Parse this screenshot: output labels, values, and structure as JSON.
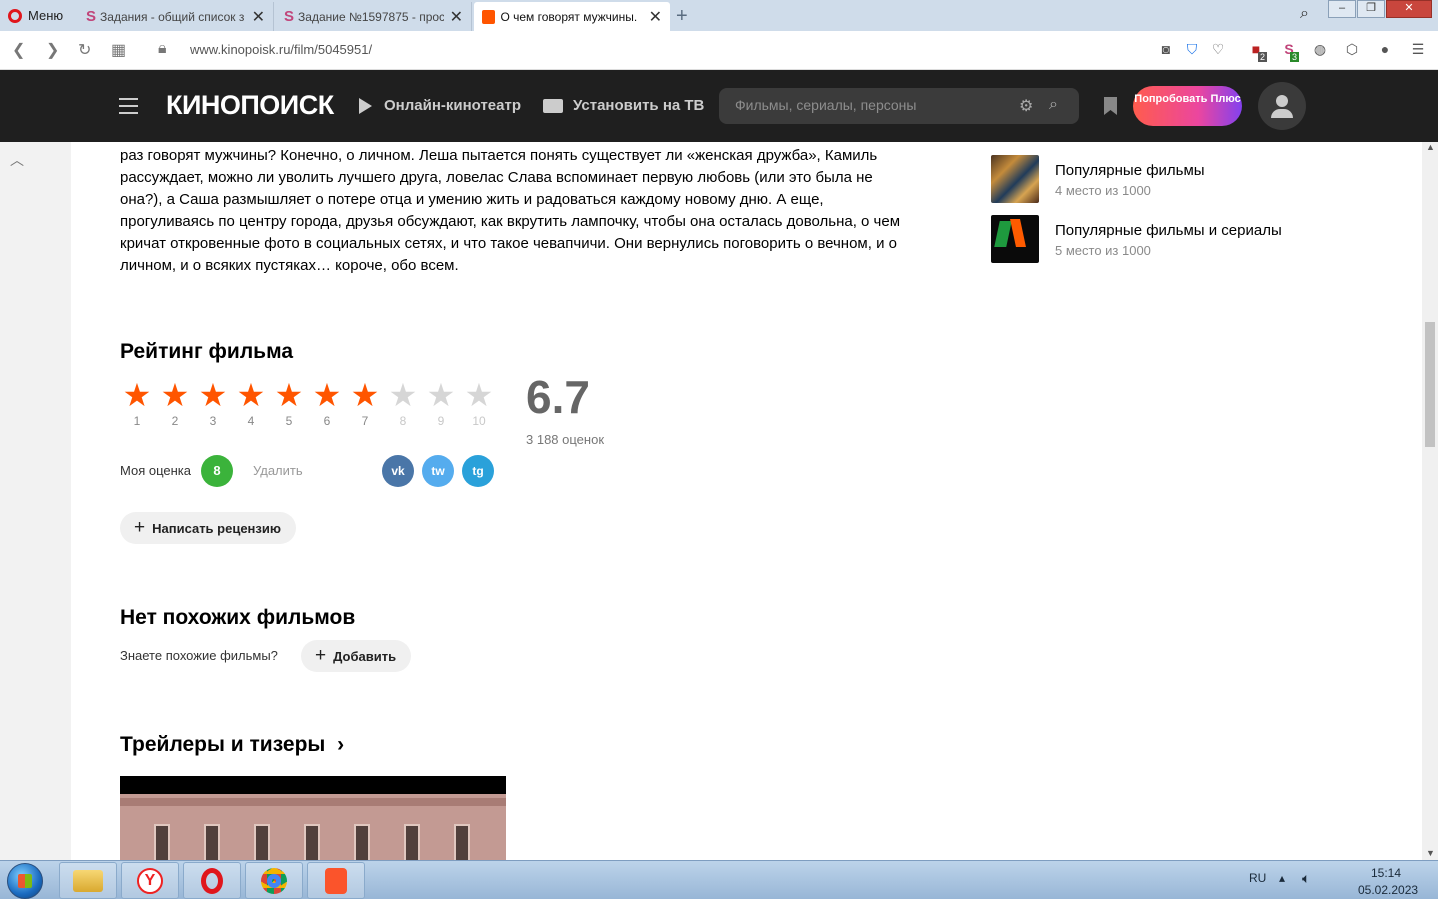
{
  "browser": {
    "menu_label": "Меню",
    "tabs": [
      {
        "icon": "SP",
        "title": "Задания - общий список з",
        "active": false
      },
      {
        "icon": "SP",
        "title": "Задание №1597875 - прос",
        "active": false
      },
      {
        "icon": "kinopoisk",
        "title": "О чем говорят мужчины. ",
        "active": true
      }
    ],
    "url": "www.kinopoisk.ru/film/5045951/",
    "ext_badges": {
      "ext1": "2",
      "ext2": "3"
    }
  },
  "header": {
    "logo": "КИНОПОИСК",
    "online_cinema": "Онлайн-кинотеатр",
    "install_tv": "Установить на ТВ",
    "search_placeholder": "Фильмы, сериалы, персоны",
    "plus_button": "Попробовать Плюс"
  },
  "synopsis": "раз говорят мужчины? Конечно, о личном. Леша пытается понять существует ли «женская дружба», Камиль рассуждает, можно ли уволить лучшего друга, ловелас Слава вспоминает первую любовь (или это была не она?), а Саша размышляет о потере отца и умению жить и радоваться каждому новому дню. А еще, прогуливаясь по центру города, друзья обсуждают, как вкрутить лампочку, чтобы она осталась довольна, о чем кричат откровенные фото в социальных сетях, и что такое чевапчичи. Они вернулись поговорить о вечном, и о личном, и о всяких пустяках… короче, обо всем.",
  "lists": [
    {
      "title": "Популярные фильмы",
      "subtitle": "4 место из 1000"
    },
    {
      "title": "Популярные фильмы и сериалы",
      "subtitle": "5 место из 1000"
    }
  ],
  "rating": {
    "heading": "Рейтинг фильма",
    "value": "6.7",
    "count": "3 188 оценок",
    "scale": [
      1,
      2,
      3,
      4,
      5,
      6,
      7,
      8,
      9,
      10
    ],
    "filled_stars": 7,
    "my_label": "Моя оценка",
    "my_score": "8",
    "delete_label": "Удалить",
    "write_review": "Написать рецензию",
    "share": {
      "vk": "vk",
      "twitter": "tw",
      "telegram": "tg"
    }
  },
  "similar": {
    "heading": "Нет похожих фильмов",
    "question": "Знаете похожие фильмы?",
    "add_label": "Добавить"
  },
  "trailers": {
    "heading": "Трейлеры и тизеры"
  },
  "taskbar": {
    "lang": "RU",
    "time": "15:14",
    "date": "05.02.2023"
  },
  "colors": {
    "accent": "#ff5500",
    "my_score": "#3bb33b",
    "vk": "#4a76a8",
    "twitter": "#55acee",
    "telegram": "#2aa1da"
  }
}
